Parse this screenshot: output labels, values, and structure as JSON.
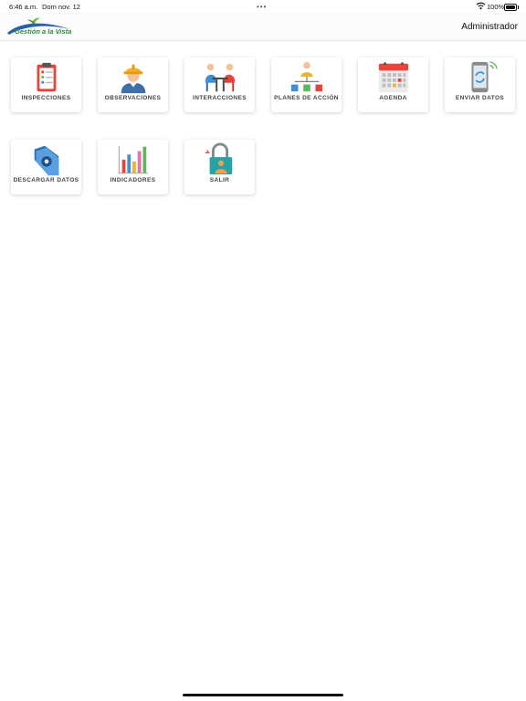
{
  "status_bar": {
    "time": "6:46 a.m.",
    "date": "Dom nov. 12",
    "dots": "•••",
    "battery": "100%"
  },
  "header": {
    "logo_text": "Gestión a la Vista",
    "user": "Administrador"
  },
  "menu": {
    "items": [
      {
        "label": "INSPECCIONES",
        "icon": "clipboard-checklist-icon"
      },
      {
        "label": "OBSERVACIONES",
        "icon": "worker-helmet-icon"
      },
      {
        "label": "INTERACCIONES",
        "icon": "people-meeting-icon"
      },
      {
        "label": "PLANES DE ACCIÓN",
        "icon": "action-plan-org-chart-icon"
      },
      {
        "label": "AGENDA",
        "icon": "calendar-icon"
      },
      {
        "label": "ENVIAR DATOS",
        "icon": "phone-sync-icon"
      },
      {
        "label": "DESCARGAR DATOS",
        "icon": "folder-download-icon"
      },
      {
        "label": "INDICADORES",
        "icon": "bar-chart-icon"
      },
      {
        "label": "SALIR",
        "icon": "padlock-user-icon"
      }
    ]
  },
  "colors": {
    "logo_green": "#2e8b3d",
    "logo_blue": "#2b5fa8"
  }
}
